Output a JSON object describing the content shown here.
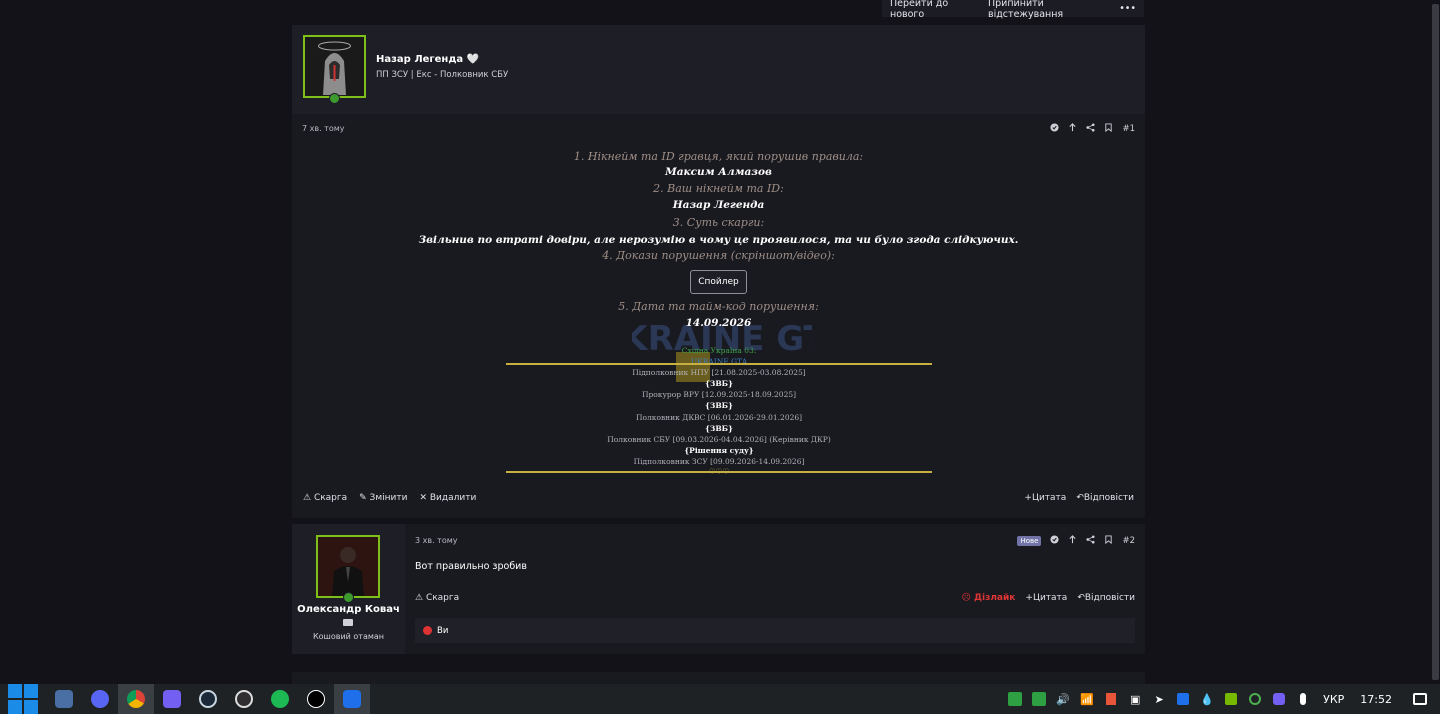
{
  "top_actions": {
    "go_new": "Перейти до нового",
    "unfollow": "Припинити відстежування",
    "more": "•••"
  },
  "post1": {
    "author": "Назар Легенда 🤍",
    "author_title": "ПП ЗСУ | Екс - Полковник СБУ",
    "time": "7 хв. тому",
    "number": "#1",
    "q1": "1. Нікнейм та ID гравця, який порушив правила:",
    "a1": "Максим Алмазов",
    "q2": "2. Ваш нікнейм та ID:",
    "a2": "Назар Легенда",
    "q3": "3. Суть скарги:",
    "a3": "Звільнив по втраті довіри, але нерозумію в чому це проявилося, та чи було згода слідкуючих.",
    "q4": "4. Докази порушення (скріншот/відео):",
    "spoiler": "Спойлер",
    "q5": "5. Дата та тайм-код порушення:",
    "a5": "14.09.2026",
    "watermark": "UKRAINE GTA",
    "signature": {
      "l1": "Східна Україна 03:",
      "l2": "UKRAINE GTA",
      "l3": "Підполковник НПУ [21.08.2025-03.08.2025]",
      "l4": "{ЗВБ}",
      "l5": "Прокурор ВРУ [12.09.2025-18.09.2025]",
      "l6": "{ЗВБ}",
      "l7": "Полковник ДКВС [06.01.2026-29.01.2026]",
      "l8": "{ЗВБ}",
      "l9": "Полковник СБУ [09.03.2026-04.04.2026] (Керівник ДКР)",
      "l10": "{Рішення суду}",
      "l11": "Підполковник ЗСУ [09.09.2026-14.09.2026]",
      "l12": "♡♡♡"
    },
    "actions": {
      "report": "Скарга",
      "edit": "Змінити",
      "delete": "Видалити",
      "quote": "Цитата",
      "reply": "Відповісти"
    }
  },
  "post2": {
    "author": "Олександр Ковач",
    "role": "Кошовий отаман",
    "time": "3 хв. тому",
    "badge": "Нове",
    "number": "#2",
    "text": "Вот правильно зробив",
    "actions": {
      "report": "Скарга",
      "dislike": "Дізлайк",
      "quote": "Цитата",
      "reply": "Відповісти"
    },
    "reaction_user": "Ви"
  },
  "taskbar": {
    "apps": [
      "windows-start",
      "remote-desktop",
      "discord",
      "chrome",
      "viber",
      "steam",
      "obs",
      "spotify",
      "tiktok",
      "app-blue"
    ],
    "lang": "УКР",
    "time": "17:52"
  }
}
